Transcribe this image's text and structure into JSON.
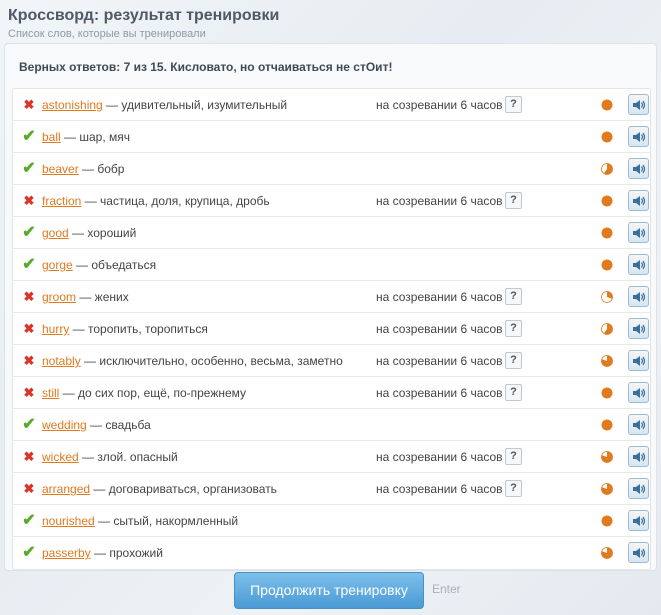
{
  "header": {
    "title": "Кроссворд: результат тренировки",
    "subtitle": "Список слов, которые вы тренировали"
  },
  "summary": "Верных ответов: 7 из 15. Кисловато, но отчаиваться не стОит!",
  "mature_label": "на созревании 6 часов",
  "help_label": "?",
  "colors": {
    "accent": "#e07a1f",
    "correct": "#5aa82a",
    "wrong": "#d9342b",
    "button": "#4a9ad6"
  },
  "rows": [
    {
      "status": "wrong",
      "word": "astonishing",
      "translation": " — удивительный, изумительный",
      "maturing": true,
      "progress": 1.0
    },
    {
      "status": "correct",
      "word": "ball",
      "translation": " — шар, мяч",
      "maturing": false,
      "progress": 1.0
    },
    {
      "status": "correct",
      "word": "beaver",
      "translation": " — бобр",
      "maturing": false,
      "progress": 0.6
    },
    {
      "status": "wrong",
      "word": "fraction",
      "translation": " — частица, доля, крупица, дробь",
      "maturing": true,
      "progress": 1.0
    },
    {
      "status": "correct",
      "word": "good",
      "translation": " — хороший",
      "maturing": false,
      "progress": 1.0
    },
    {
      "status": "correct",
      "word": "gorge",
      "translation": " — объедаться",
      "maturing": false,
      "progress": 1.0
    },
    {
      "status": "wrong",
      "word": "groom",
      "translation": " — жених",
      "maturing": true,
      "progress": 0.3
    },
    {
      "status": "wrong",
      "word": "hurry",
      "translation": " — торопить, торопиться",
      "maturing": true,
      "progress": 0.6
    },
    {
      "status": "wrong",
      "word": "notably",
      "translation": " — исключительно, особенно, весьма, заметно",
      "maturing": true,
      "progress": 0.8
    },
    {
      "status": "wrong",
      "word": "still",
      "translation": " — до сих пор, ещё, по-прежнему",
      "maturing": true,
      "progress": 1.0
    },
    {
      "status": "correct",
      "word": "wedding",
      "translation": " — свадьба",
      "maturing": false,
      "progress": 1.0
    },
    {
      "status": "wrong",
      "word": "wicked",
      "translation": " — злой. опасный",
      "maturing": true,
      "progress": 0.8
    },
    {
      "status": "wrong",
      "word": "arranged",
      "translation": " — договариваться, организовать",
      "maturing": true,
      "progress": 0.8
    },
    {
      "status": "correct",
      "word": "nourished",
      "translation": " — сытый, накормленный",
      "maturing": false,
      "progress": 1.0
    },
    {
      "status": "correct",
      "word": "passerby",
      "translation": " — прохожий",
      "maturing": false,
      "progress": 0.8
    }
  ],
  "footer": {
    "continue_label": "Продолжить тренировку",
    "enter_hint": "Enter"
  }
}
